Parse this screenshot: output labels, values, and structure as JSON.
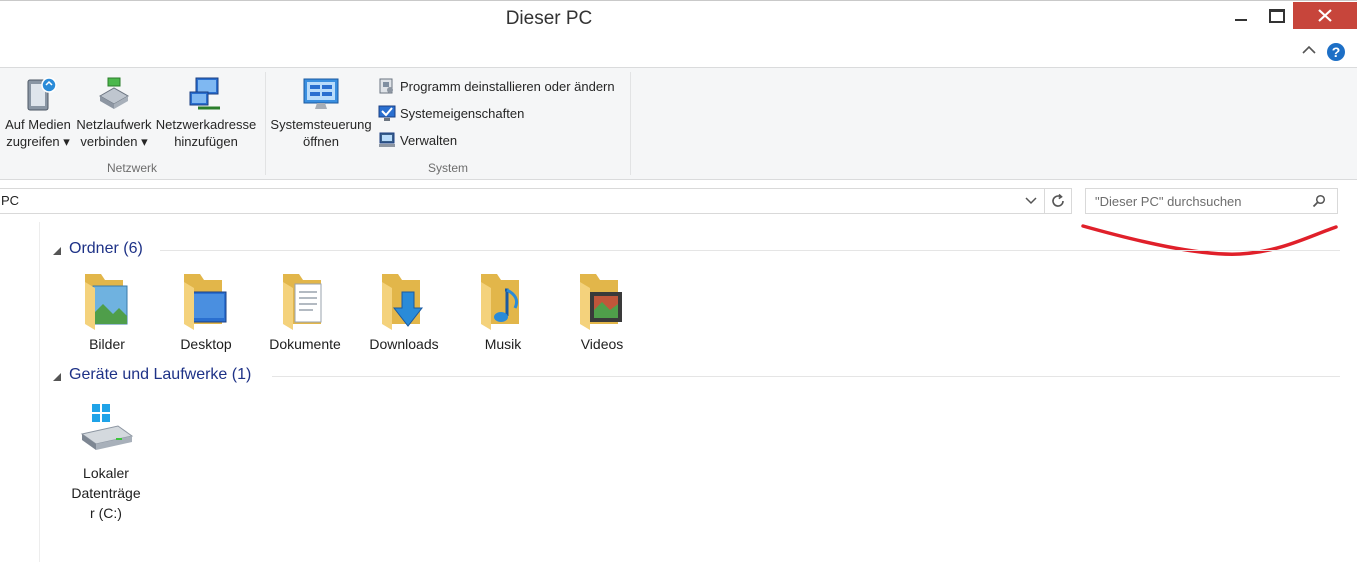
{
  "window": {
    "title": "Dieser PC",
    "controls": {
      "minimize": "minimize-icon",
      "maximize": "maximize-icon",
      "close": "close-icon"
    }
  },
  "tabstrip": {
    "collapse_icon": "chevron-up-icon",
    "help_icon": "help-icon",
    "help_glyph": "?"
  },
  "ribbon": {
    "groups": [
      {
        "label": "Netzwerk",
        "buttons": [
          {
            "line1": "Auf Medien",
            "line2": "zugreifen ▾",
            "icon": "media-server-icon"
          },
          {
            "line1": "Netzlaufwerk",
            "line2": "verbinden ▾",
            "icon": "network-drive-icon"
          },
          {
            "line1": "Netzwerkadresse",
            "line2": "hinzufügen",
            "icon": "network-location-icon"
          }
        ]
      },
      {
        "label": "System",
        "buttons": [
          {
            "line1": "Systemsteuerung",
            "line2": "öffnen",
            "icon": "control-panel-icon"
          }
        ],
        "small_buttons": [
          {
            "label": "Programm deinstallieren oder ändern",
            "icon": "uninstall-icon"
          },
          {
            "label": "Systemeigenschaften",
            "icon": "system-properties-icon"
          },
          {
            "label": "Verwalten",
            "icon": "manage-icon"
          }
        ]
      }
    ]
  },
  "address": {
    "path": "PC"
  },
  "search": {
    "placeholder": "\"Dieser PC\" durchsuchen"
  },
  "colors": {
    "accent": "#1e3287",
    "close_button": "#c7453b",
    "annotation": "#e0202a"
  },
  "sections": [
    {
      "title": "Ordner (6)",
      "items": [
        {
          "label": "Bilder",
          "icon": "pictures-folder-icon"
        },
        {
          "label": "Desktop",
          "icon": "desktop-folder-icon"
        },
        {
          "label": "Dokumente",
          "icon": "documents-folder-icon"
        },
        {
          "label": "Downloads",
          "icon": "downloads-folder-icon"
        },
        {
          "label": "Musik",
          "icon": "music-folder-icon"
        },
        {
          "label": "Videos",
          "icon": "videos-folder-icon"
        }
      ]
    },
    {
      "title": "Geräte und Laufwerke (1)",
      "items": [
        {
          "label_line1": "Lokaler",
          "label_line2": "Datenträge",
          "label_line3": "r (C:)",
          "icon": "local-disk-icon"
        }
      ]
    }
  ]
}
